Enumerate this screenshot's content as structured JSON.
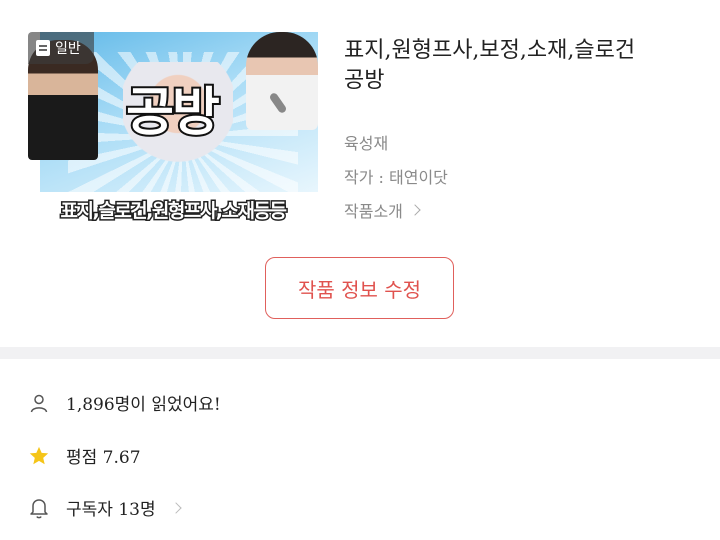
{
  "cover": {
    "badge_label": "일반",
    "big_title": "공방",
    "caption": "표지,슬로건,원형프사,소재등등"
  },
  "work": {
    "title_line1": "표지,원형프사,보정,소재,슬로건",
    "title_line2": "공방",
    "author_name": "육성재",
    "writer": "작가 : 태연이닷",
    "intro_link": "작품소개"
  },
  "edit_button_label": "작품 정보 수정",
  "stats": {
    "readers": "1,896명이 읽었어요!",
    "rating": "평점 7.67",
    "subscribers": "구독자 13명"
  },
  "colors": {
    "accent": "#e0524e",
    "star": "#f5c518",
    "divider": "#f1f1f3"
  },
  "icons": [
    "document-icon",
    "person-icon",
    "star-icon",
    "bell-icon",
    "chevron-right-icon"
  ]
}
